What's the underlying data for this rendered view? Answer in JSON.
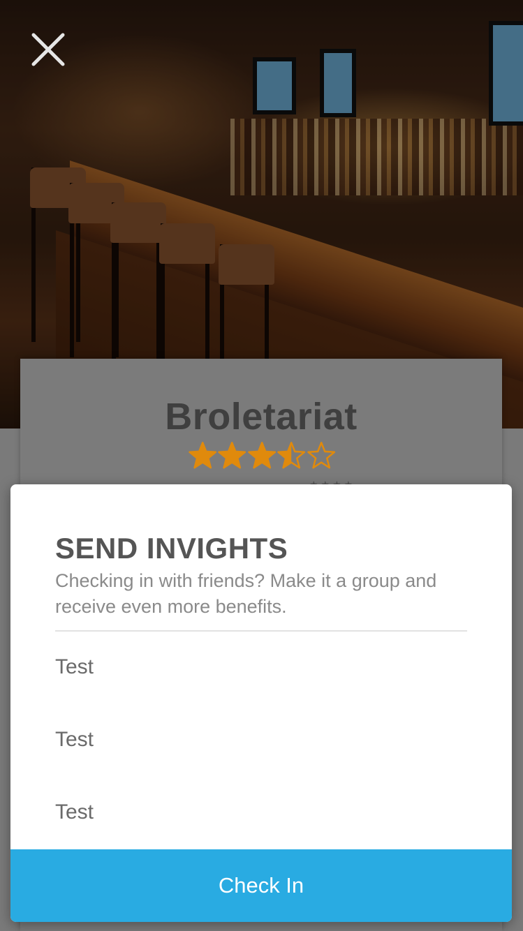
{
  "venue": {
    "name": "Broletariat",
    "rating": 3.5,
    "rating_max": 5,
    "star_color": "#e08a0c"
  },
  "modal": {
    "title": "SEND INVIGHTS",
    "subtitle": "Checking in with friends? Make it a group and receive even more benefits.",
    "friends": [
      "Test",
      "Test",
      "Test"
    ],
    "action_label": "Check In",
    "action_color": "#29abe2"
  },
  "icons": {
    "close": "close-icon",
    "star": "star-icon"
  }
}
